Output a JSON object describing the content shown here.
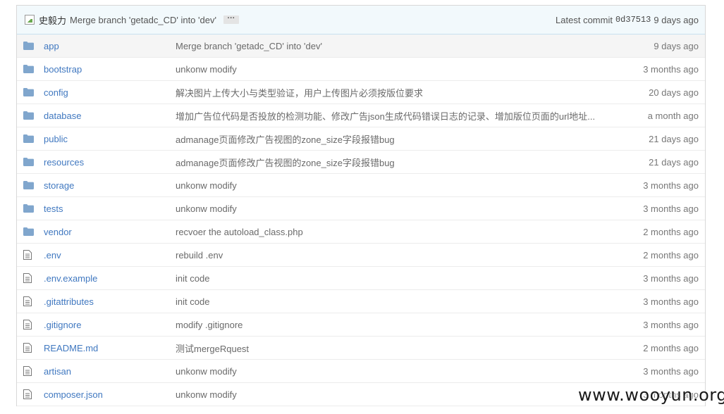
{
  "commit_tease": {
    "author": "史毅力",
    "message": "Merge branch 'getadc_CD' into 'dev'",
    "ellipsis": "···",
    "latest_label": "Latest commit",
    "sha": "0d37513",
    "age": "9 days ago"
  },
  "files": [
    {
      "type": "folder",
      "name": "app",
      "message": "Merge branch 'getadc_CD' into 'dev'",
      "age": "9 days ago"
    },
    {
      "type": "folder",
      "name": "bootstrap",
      "message": "unkonw modify",
      "age": "3 months ago"
    },
    {
      "type": "folder",
      "name": "config",
      "message": "解决图片上传大小与类型验证，用户上传图片必须按版位要求",
      "age": "20 days ago"
    },
    {
      "type": "folder",
      "name": "database",
      "message": "增加广告位代码是否投放的检测功能、修改广告json生成代码错误日志的记录、增加版位页面的url地址...",
      "age": "a month ago"
    },
    {
      "type": "folder",
      "name": "public",
      "message": "admanage页面修改广告视图的zone_size字段报错bug",
      "age": "21 days ago"
    },
    {
      "type": "folder",
      "name": "resources",
      "message": "admanage页面修改广告视图的zone_size字段报错bug",
      "age": "21 days ago"
    },
    {
      "type": "folder",
      "name": "storage",
      "message": "unkonw modify",
      "age": "3 months ago"
    },
    {
      "type": "folder",
      "name": "tests",
      "message": "unkonw modify",
      "age": "3 months ago"
    },
    {
      "type": "folder",
      "name": "vendor",
      "message": "recvoer the autoload_class.php",
      "age": "2 months ago"
    },
    {
      "type": "file",
      "name": ".env",
      "message": "rebuild .env",
      "age": "2 months ago"
    },
    {
      "type": "file",
      "name": ".env.example",
      "message": "init code",
      "age": "3 months ago"
    },
    {
      "type": "file",
      "name": ".gitattributes",
      "message": "init code",
      "age": "3 months ago"
    },
    {
      "type": "file",
      "name": ".gitignore",
      "message": "modify .gitignore",
      "age": "3 months ago"
    },
    {
      "type": "file",
      "name": "README.md",
      "message": "测试mergeRquest",
      "age": "2 months ago"
    },
    {
      "type": "file",
      "name": "artisan",
      "message": "unkonw modify",
      "age": "3 months ago"
    },
    {
      "type": "file",
      "name": "composer.json",
      "message": "unkonw modify",
      "age": "3 months ago"
    }
  ],
  "watermark": "www.wooyun.org",
  "colors": {
    "link": "#4078c0",
    "folder_icon": "#80a6cd",
    "file_icon": "#777777",
    "commit_bg": "#f2f9fc"
  }
}
